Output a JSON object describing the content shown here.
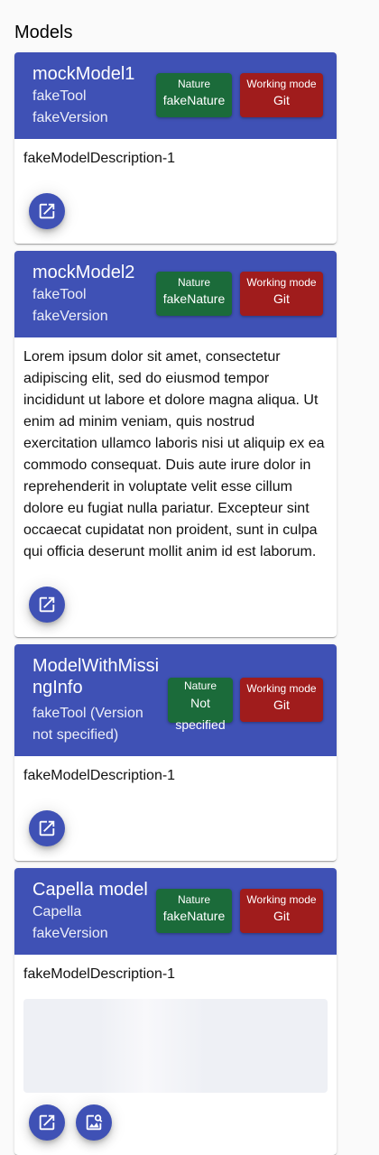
{
  "section": {
    "title": "Models"
  },
  "colors": {
    "header": "#3f51b5",
    "nature_chip": "#1b6b3a",
    "mode_chip": "#a01c1c"
  },
  "models": [
    {
      "name": "mockModel1",
      "tool": "fakeTool",
      "version": "fakeVersion",
      "nature_caption": "Nature",
      "nature": "fakeNature",
      "mode_caption": "Working mode",
      "mode": "Git",
      "description": "fakeModelDescription-1",
      "open_icon": "open-in-new-icon"
    },
    {
      "name": "mockModel2",
      "tool": "fakeTool",
      "version": "fakeVersion",
      "nature_caption": "Nature",
      "nature": "fakeNature",
      "mode_caption": "Working mode",
      "mode": "Git",
      "description": "Lorem ipsum dolor sit amet, consectetur adipiscing elit, sed do eiusmod tempor incididunt ut labore et dolore magna aliqua. Ut enim ad minim veniam, quis nostrud exercitation ullamco laboris nisi ut aliquip ex ea commodo consequat. Duis aute irure dolor in reprehenderit in voluptate velit esse cillum dolore eu fugiat nulla pariatur. Excepteur sint occaecat cupidatat non proident, sunt in culpa qui officia deserunt mollit anim id est laborum.",
      "open_icon": "open-in-new-icon"
    },
    {
      "name": "ModelWithMissingInfo",
      "tool_version": "fakeTool (Version not specified)",
      "nature_caption": "Nature",
      "nature": "Not specified",
      "mode_caption": "Working mode",
      "mode": "Git",
      "description": "fakeModelDescription-1",
      "open_icon": "open-in-new-icon"
    },
    {
      "name": "Capella model",
      "tool": "Capella",
      "version": "fakeVersion",
      "nature_caption": "Nature",
      "nature": "fakeNature",
      "mode_caption": "Working mode",
      "mode": "Git",
      "description": "fakeModelDescription-1",
      "open_icon": "open-in-new-icon",
      "diagram_icon": "image-search-icon"
    }
  ]
}
